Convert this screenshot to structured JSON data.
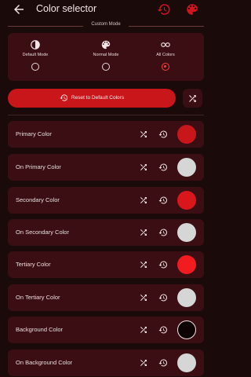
{
  "appbar": {
    "title": "Color selector"
  },
  "section": {
    "title": "Custom Mode"
  },
  "modes": [
    {
      "label": "Default Mode",
      "icon": "contrast-icon",
      "selected": false
    },
    {
      "label": "Normal Mode",
      "icon": "palette-icon",
      "selected": false
    },
    {
      "label": "All Colors",
      "icon": "infinity-icon",
      "selected": true
    }
  ],
  "reset": {
    "label": "Reset to Default Colors"
  },
  "colors": [
    {
      "label": "Primary Color",
      "swatch": "#c8161b"
    },
    {
      "label": "On Primary Color",
      "swatch": "#d6d6d6"
    },
    {
      "label": "Secondary Color",
      "swatch": "#d8161b"
    },
    {
      "label": "On Secondary Color",
      "swatch": "#d6d6d6"
    },
    {
      "label": "Tertiary Color",
      "swatch": "#f01c20"
    },
    {
      "label": "On Tertiary Color",
      "swatch": "#d6d6d6"
    },
    {
      "label": "Background Color",
      "swatch": "#0d0303"
    },
    {
      "label": "On Background Color",
      "swatch": "#d6d6d6"
    }
  ],
  "theme": {
    "accent": "#c8161b",
    "card": "#3a0e12",
    "background": "#1a0a0a"
  }
}
